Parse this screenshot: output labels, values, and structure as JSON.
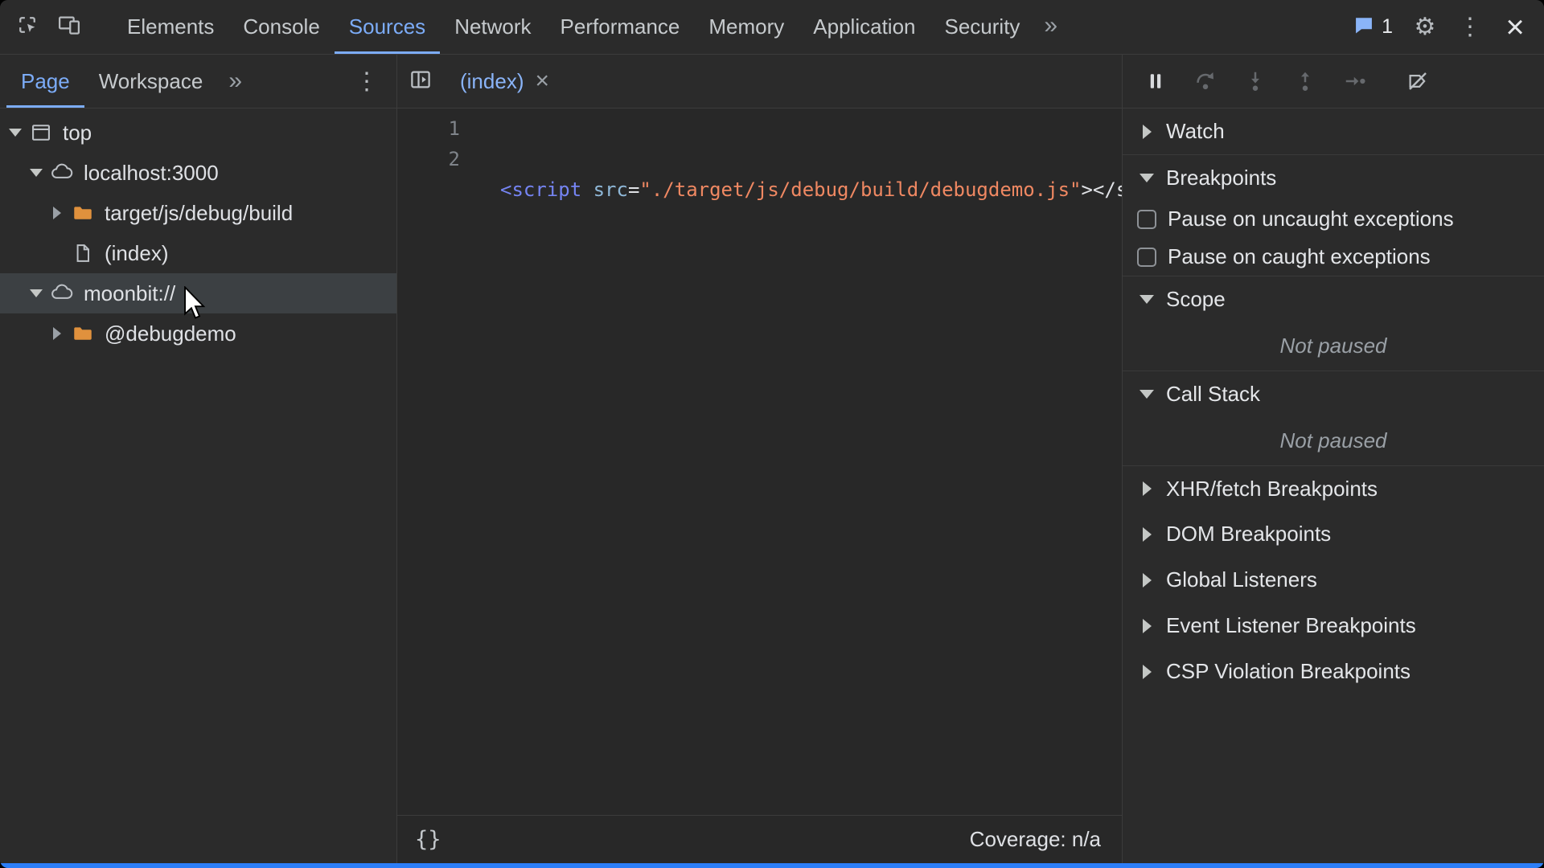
{
  "topbar": {
    "tabs": [
      "Elements",
      "Console",
      "Sources",
      "Network",
      "Performance",
      "Memory",
      "Application",
      "Security"
    ],
    "more_tabs": "»",
    "message_count": "1"
  },
  "icons": {
    "gear": "⚙",
    "kebab": "⋮",
    "close": "×",
    "tab_close": "×",
    "pretty_print": "{}"
  },
  "navigator": {
    "tab_page": "Page",
    "tab_workspace": "Workspace",
    "more": "»",
    "tree": [
      {
        "label": "top",
        "icon": "frame-icon"
      },
      {
        "label": "localhost:3000",
        "icon": "cloud-icon"
      },
      {
        "label": "target/js/debug/build",
        "icon": "folder-icon"
      },
      {
        "label": "(index)",
        "icon": "file-icon"
      },
      {
        "label": "moonbit://",
        "icon": "cloud-icon"
      },
      {
        "label": "@debugdemo",
        "icon": "folder-icon"
      }
    ]
  },
  "editor": {
    "tab_label": "(index)",
    "lines": {
      "n1": "1",
      "n2": "2"
    },
    "code": {
      "tag_open": "<script",
      "attr": " src",
      "equals": "=",
      "string": "\"./target/js/debug/build/debugdemo.js\"",
      "tail": "></s"
    },
    "coverage": "Coverage: n/a"
  },
  "debugger_panel": {
    "watch": "Watch",
    "breakpoints": "Breakpoints",
    "pause_uncaught": "Pause on uncaught exceptions",
    "pause_caught": "Pause on caught exceptions",
    "scope": "Scope",
    "scope_status": "Not paused",
    "call_stack": "Call Stack",
    "call_stack_status": "Not paused",
    "xhr_fetch": "XHR/fetch Breakpoints",
    "dom": "DOM Breakpoints",
    "global_listeners": "Global Listeners",
    "event_listener": "Event Listener Breakpoints",
    "csp_violation": "CSP Violation Breakpoints"
  },
  "colors": {
    "accent_blue": "#7cacf8",
    "tag_token": "#7584f2",
    "attr_token": "#8fb8d8",
    "string_token": "#ef8862",
    "folder_orange": "#e0913d",
    "selection_gray": "#3c4043",
    "bottom_bar_blue": "#2c7ef8"
  }
}
